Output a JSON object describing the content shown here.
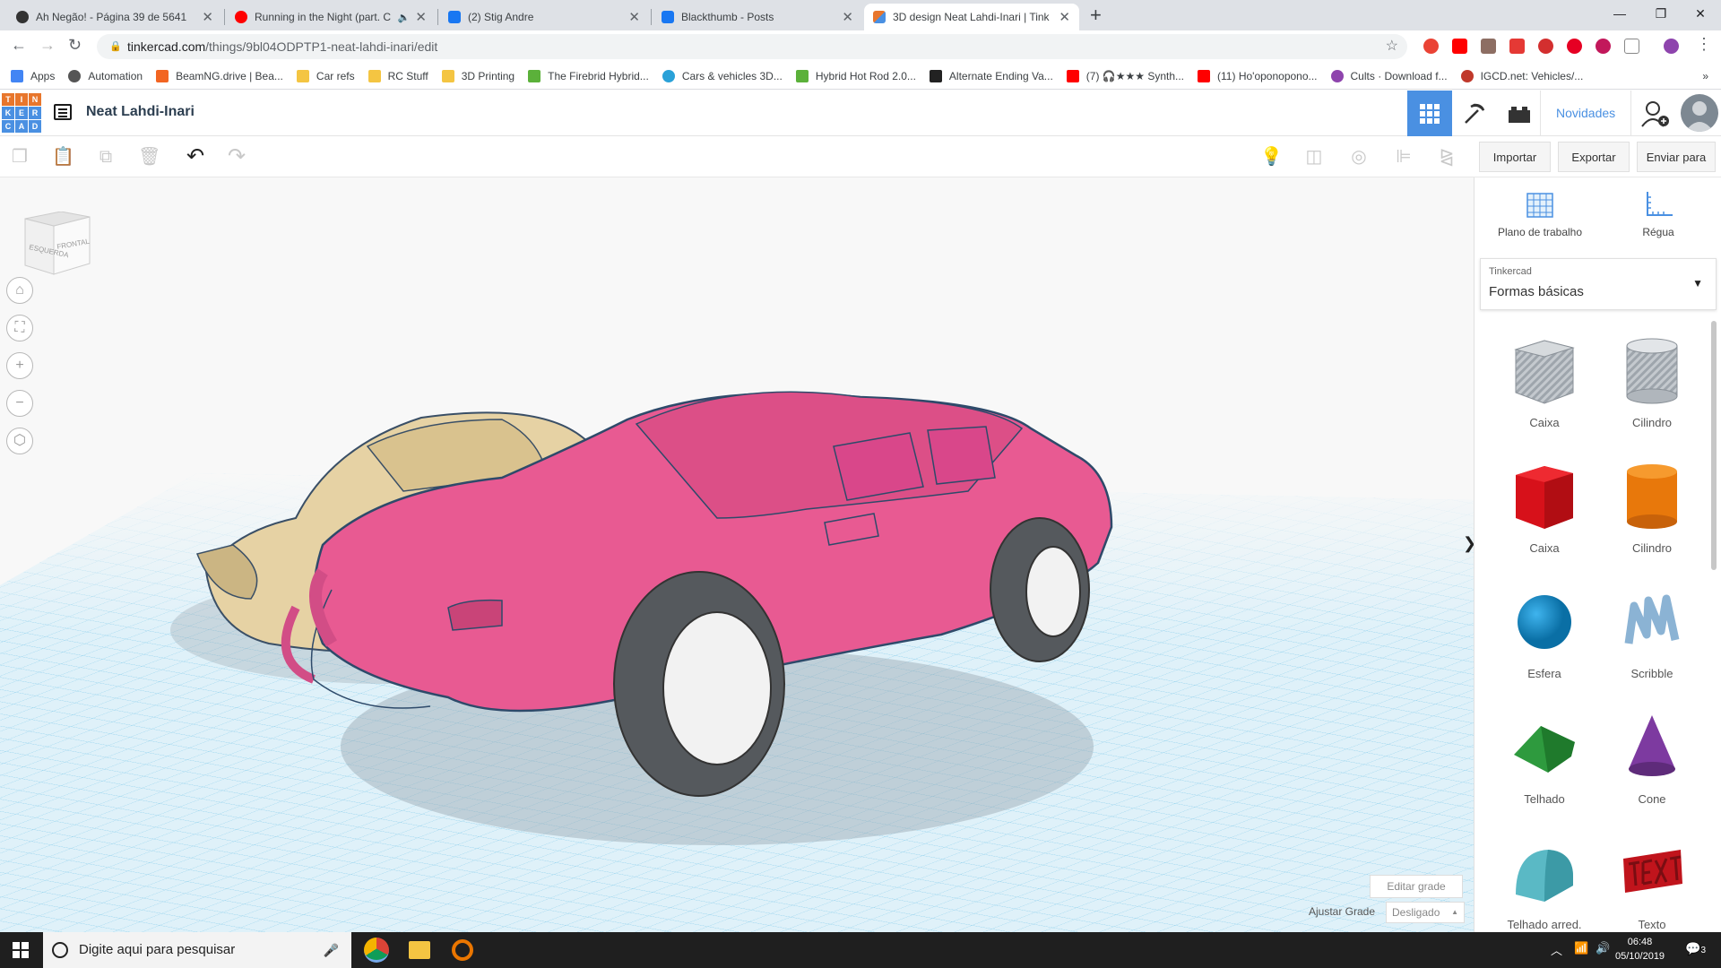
{
  "browser": {
    "tabs": [
      {
        "title": "Ah Negão! - Página 39 de 5641",
        "favicon_color": "#333333"
      },
      {
        "title": "Running in the Night (part. C",
        "favicon_color": "#ff0000"
      },
      {
        "title": "(2) Stig Andre",
        "favicon_color": "#1877f2"
      },
      {
        "title": "Blackthumb - Posts",
        "favicon_color": "#1877f2"
      },
      {
        "title": "3D design Neat Lahdi-Inari | Tink",
        "favicon_color": "#e8762c"
      }
    ],
    "url_domain": "tinkercad.com",
    "url_path": "/things/9bl04ODPTP1-neat-lahdi-inari/edit",
    "bookmarks": [
      {
        "label": "Apps",
        "icon_color": "#4285f4"
      },
      {
        "label": "Automation",
        "icon_color": "#555555"
      },
      {
        "label": "BeamNG.drive | Bea...",
        "icon_color": "#f26522"
      },
      {
        "label": "Car refs",
        "icon_color": "#f4c542"
      },
      {
        "label": "RC Stuff",
        "icon_color": "#f4c542"
      },
      {
        "label": "3D Printing",
        "icon_color": "#f4c542"
      },
      {
        "label": "The Firebrid Hybrid...",
        "icon_color": "#5bb13a"
      },
      {
        "label": "Cars & vehicles 3D...",
        "icon_color": "#2aa1d8"
      },
      {
        "label": "Hybrid Hot Rod 2.0...",
        "icon_color": "#5bb13a"
      },
      {
        "label": "Alternate Ending Va...",
        "icon_color": "#222222"
      },
      {
        "label": "(7) 🎧★★★ Synth...",
        "icon_color": "#ff0000"
      },
      {
        "label": "(11) Ho'oponopono...",
        "icon_color": "#ff0000"
      },
      {
        "label": "Cults · Download f...",
        "icon_color": "#8e44ad"
      },
      {
        "label": "IGCD.net: Vehicles/...",
        "icon_color": "#c0392b"
      }
    ]
  },
  "app": {
    "logo_letters": [
      "T",
      "I",
      "N",
      "K",
      "E",
      "R",
      "C",
      "A",
      "D"
    ],
    "design_name": "Neat Lahdi-Inari",
    "novidades": "Novidades",
    "import_label": "Importar",
    "export_label": "Exportar",
    "send_label": "Enviar para"
  },
  "viewport": {
    "viewcube_left": "ESQUERDA",
    "viewcube_front": "FRONTAL",
    "edit_grid": "Editar grade",
    "snap_label": "Ajustar Grade",
    "snap_value": "Desligado"
  },
  "panel": {
    "workplane": "Plano de trabalho",
    "ruler": "Régua",
    "category_source": "Tinkercad",
    "category": "Formas básicas",
    "shapes": [
      {
        "label": "Caixa",
        "icon": "striped-box-icon"
      },
      {
        "label": "Cilindro",
        "icon": "striped-cylinder-icon"
      },
      {
        "label": "Caixa",
        "icon": "red-box-icon"
      },
      {
        "label": "Cilindro",
        "icon": "orange-cylinder-icon"
      },
      {
        "label": "Esfera",
        "icon": "blue-sphere-icon"
      },
      {
        "label": "Scribble",
        "icon": "scribble-icon"
      },
      {
        "label": "Telhado",
        "icon": "green-roof-icon"
      },
      {
        "label": "Cone",
        "icon": "purple-cone-icon"
      },
      {
        "label": "Telhado arred.",
        "icon": "teal-round-roof-icon"
      },
      {
        "label": "Texto",
        "icon": "red-text-icon"
      }
    ]
  },
  "taskbar": {
    "search_placeholder": "Digite aqui para pesquisar",
    "time": "06:48",
    "date": "05/10/2019",
    "notification_count": "3"
  },
  "colors": {
    "accent": "#4a90e2",
    "grid": "#7fc8e8",
    "pink_car": "#e85a92",
    "tan_car": "#e6d2a4"
  }
}
